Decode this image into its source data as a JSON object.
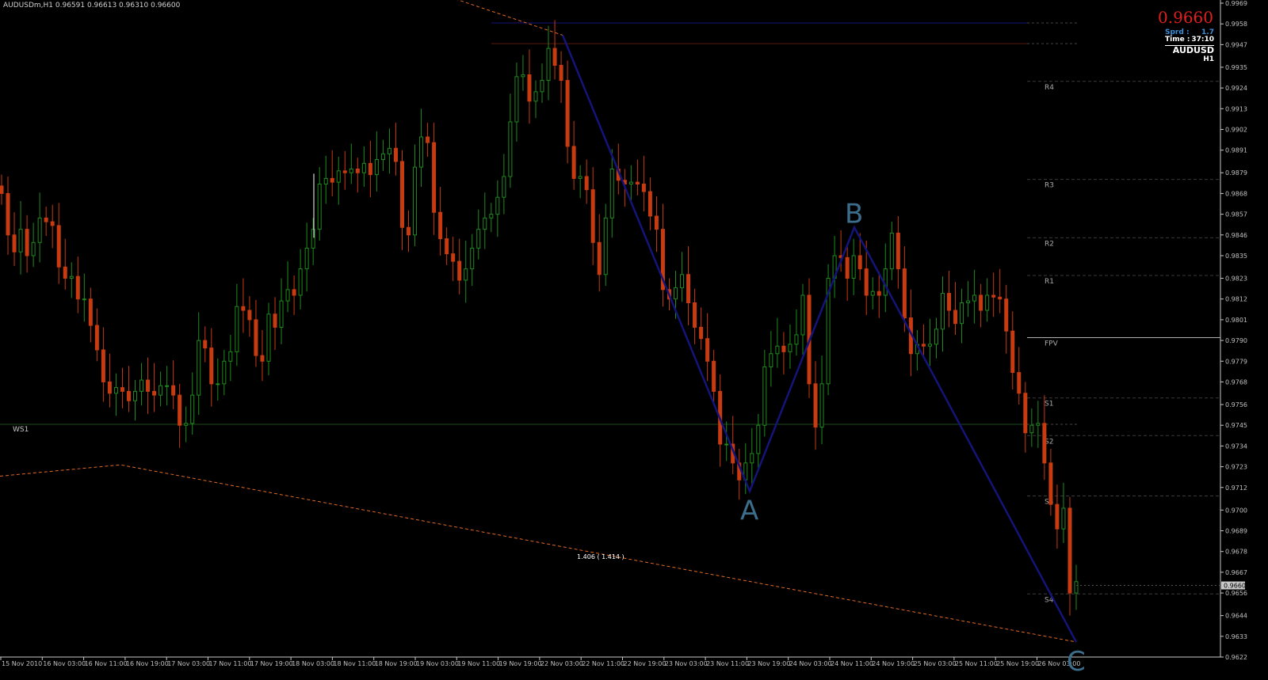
{
  "header": {
    "title": "AUDUSDm,H1  0.96591 0.96613 0.96310 0.96600"
  },
  "info": {
    "big_price": "0.9660",
    "spread_label": "Sprd :",
    "spread_value": "1.7",
    "time_label": "Time :",
    "time_value": "37:10",
    "symbol": "AUDUSD",
    "timeframe": "H1"
  },
  "colors": {
    "background": "#000000",
    "bull": "#1f8a1f",
    "bear": "#c83a10",
    "zigzag": "#14147a",
    "trend": "#e06a25",
    "labels": "#3c6e8c"
  },
  "chart_data": {
    "type": "candlestick",
    "symbol": "AUDUSDm",
    "timeframe": "H1",
    "ylim": [
      0.9622,
      0.9969
    ],
    "y_ticks": [
      "0.9969",
      "0.9958",
      "0.9947",
      "0.9935",
      "0.9924",
      "0.9913",
      "0.9902",
      "0.9891",
      "0.9879",
      "0.9868",
      "0.9857",
      "0.9846",
      "0.9835",
      "0.9823",
      "0.9812",
      "0.9801",
      "0.9790",
      "0.9779",
      "0.9768",
      "0.9756",
      "0.9745",
      "0.9734",
      "0.9723",
      "0.9712",
      "0.9700",
      "0.9689",
      "0.9678",
      "0.9667",
      "0.9656",
      "0.9644",
      "0.9633",
      "0.9622"
    ],
    "x_ticks": [
      "15 Nov 2010",
      "16 Nov 03:00",
      "16 Nov 11:00",
      "16 Nov 19:00",
      "17 Nov 03:00",
      "17 Nov 11:00",
      "17 Nov 19:00",
      "18 Nov 03:00",
      "18 Nov 11:00",
      "18 Nov 19:00",
      "19 Nov 03:00",
      "19 Nov 11:00",
      "19 Nov 19:00",
      "22 Nov 03:00",
      "22 Nov 11:00",
      "22 Nov 19:00",
      "23 Nov 03:00",
      "23 Nov 11:00",
      "23 Nov 19:00",
      "24 Nov 03:00",
      "24 Nov 11:00",
      "24 Nov 19:00",
      "25 Nov 03:00",
      "25 Nov 11:00",
      "25 Nov 19:00",
      "26 Nov 03:00"
    ],
    "current_price": "0.9660",
    "pivot_levels": [
      {
        "name": "R4",
        "value": 0.99275
      },
      {
        "name": "R3",
        "value": 0.98755
      },
      {
        "name": "R2",
        "value": 0.98445
      },
      {
        "name": "R1",
        "value": 0.98245
      },
      {
        "name": "FPV",
        "value": 0.97915
      },
      {
        "name": "S1",
        "value": 0.97595
      },
      {
        "name": "S2",
        "value": 0.97395
      },
      {
        "name": "S3",
        "value": 0.97075
      },
      {
        "name": "S4",
        "value": 0.96555
      }
    ],
    "weekly_level": {
      "name": "WS1",
      "value": 0.97455
    },
    "top_levels": [
      0.99585,
      0.99475
    ],
    "zigzag": [
      {
        "label": "",
        "x": 710,
        "price": 0.9952
      },
      {
        "label": "A",
        "x": 946,
        "price": 0.971
      },
      {
        "label": "B",
        "x": 1078,
        "price": 0.985
      },
      {
        "label": "C",
        "x": 1358,
        "price": 0.963
      }
    ],
    "projection_label": "1.406 ( 1.414 )",
    "fib_anchor_points": [
      {
        "x": 0,
        "price": 0.9718
      },
      {
        "x": 152,
        "price": 0.9724
      },
      {
        "x": 1358,
        "price": 0.963
      }
    ],
    "trend_top": [
      {
        "x": 548,
        "price": 0.9975
      },
      {
        "x": 710,
        "price": 0.9952
      }
    ],
    "closes": [
      0.9868,
      0.9846,
      0.9837,
      0.9849,
      0.9835,
      0.9842,
      0.9855,
      0.9853,
      0.9851,
      0.9829,
      0.9823,
      0.9824,
      0.9812,
      0.9812,
      0.9798,
      0.9785,
      0.9768,
      0.9762,
      0.9765,
      0.9763,
      0.9758,
      0.9763,
      0.9769,
      0.9763,
      0.9761,
      0.9766,
      0.9766,
      0.9761,
      0.9745,
      0.9746,
      0.9761,
      0.979,
      0.9786,
      0.9767,
      0.9767,
      0.9779,
      0.9784,
      0.9808,
      0.9806,
      0.9801,
      0.9782,
      0.9779,
      0.9804,
      0.9797,
      0.9811,
      0.9817,
      0.9814,
      0.9828,
      0.9839,
      0.9849,
      0.9873,
      0.9876,
      0.9874,
      0.988,
      0.9879,
      0.9881,
      0.9879,
      0.9884,
      0.9878,
      0.9886,
      0.9889,
      0.9892,
      0.9885,
      0.985,
      0.9846,
      0.9882,
      0.9898,
      0.9895,
      0.9858,
      0.9844,
      0.9836,
      0.9832,
      0.9822,
      0.9828,
      0.9839,
      0.9849,
      0.9855,
      0.9857,
      0.9866,
      0.9877,
      0.9906,
      0.993,
      0.9931,
      0.9917,
      0.9922,
      0.9928,
      0.9945,
      0.9936,
      0.9928,
      0.9893,
      0.9876,
      0.9877,
      0.987,
      0.9842,
      0.9825,
      0.9855,
      0.9881,
      0.9875,
      0.9873,
      0.9874,
      0.9873,
      0.9869,
      0.9856,
      0.9849,
      0.9817,
      0.9812,
      0.9818,
      0.9825,
      0.981,
      0.9797,
      0.9791,
      0.9779,
      0.9763,
      0.9735,
      0.9735,
      0.9725,
      0.9716,
      0.9725,
      0.973,
      0.9745,
      0.9776,
      0.9783,
      0.9787,
      0.9784,
      0.9788,
      0.9793,
      0.9814,
      0.9767,
      0.9744,
      0.9767,
      0.9823,
      0.9835,
      0.9834,
      0.9823,
      0.9835,
      0.9828,
      0.9814,
      0.9816,
      0.9814,
      0.9828,
      0.9847,
      0.9828,
      0.9802,
      0.9783,
      0.9788,
      0.9787,
      0.9788,
      0.9796,
      0.9815,
      0.9806,
      0.9799,
      0.981,
      0.9811,
      0.9814,
      0.9806,
      0.9814,
      0.9813,
      0.9812,
      0.9795,
      0.9773,
      0.9762,
      0.9741,
      0.9745,
      0.9746,
      0.9725,
      0.9703,
      0.969,
      0.9701,
      0.9656,
      0.9662
    ]
  }
}
